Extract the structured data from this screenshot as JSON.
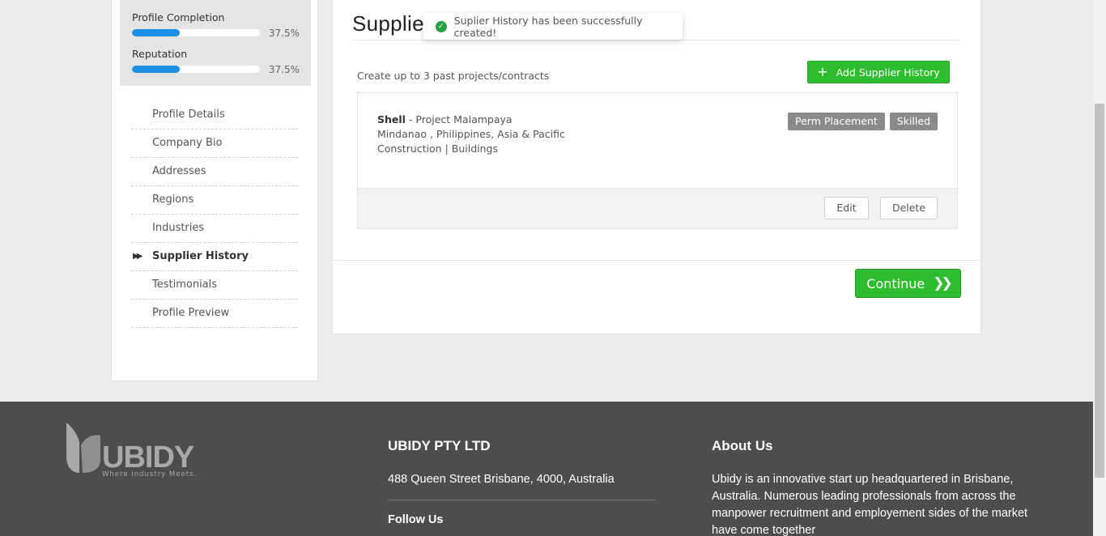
{
  "sidebar": {
    "stats": [
      {
        "label": "Profile Completion",
        "value": "37.5%",
        "fraction": 0.375
      },
      {
        "label": "Reputation",
        "value": "37.5%",
        "fraction": 0.375
      }
    ],
    "nav": [
      {
        "label": "Profile Details",
        "active": false
      },
      {
        "label": "Company Bio",
        "active": false
      },
      {
        "label": "Addresses",
        "active": false
      },
      {
        "label": "Regions",
        "active": false
      },
      {
        "label": "Industries",
        "active": false
      },
      {
        "label": "Supplier History",
        "active": true
      },
      {
        "label": "Testimonials",
        "active": false
      },
      {
        "label": "Profile Preview",
        "active": false
      }
    ]
  },
  "main": {
    "title": "Supplie",
    "intro": "Create up to 3 past projects/contracts",
    "add_button": "Add Supplier History",
    "history": {
      "client": "Shell",
      "project": " - Project Malampaya",
      "location": "Mindanao , Philippines, Asia & Pacific",
      "sector": "Construction | Buildings",
      "tags": [
        "Perm Placement",
        "Skilled"
      ],
      "edit_label": "Edit",
      "delete_label": "Delete"
    },
    "continue_label": "Continue"
  },
  "toast": {
    "message": "Suplier History has been successfully created!"
  },
  "footer": {
    "logo_text": "UBIDY",
    "logo_tagline": "Where Industry Meets.",
    "company_name": "UBIDY PTY LTD",
    "address": "488 Queen Street Brisbane, 4000, Australia",
    "follow_label": "Follow Us",
    "about_title": "About Us",
    "about_text": "Ubidy is an innovative start up headquartered in Brisbane, Australia. Numerous leading professionals from across the manpower recruitment and employement sides of the market have come together"
  },
  "colors": {
    "accent_green": "#2ebd2e",
    "progress_blue": "#1e8fe6",
    "footer_bg": "#4d4d4d",
    "tag_gray": "#8a8a8a"
  }
}
